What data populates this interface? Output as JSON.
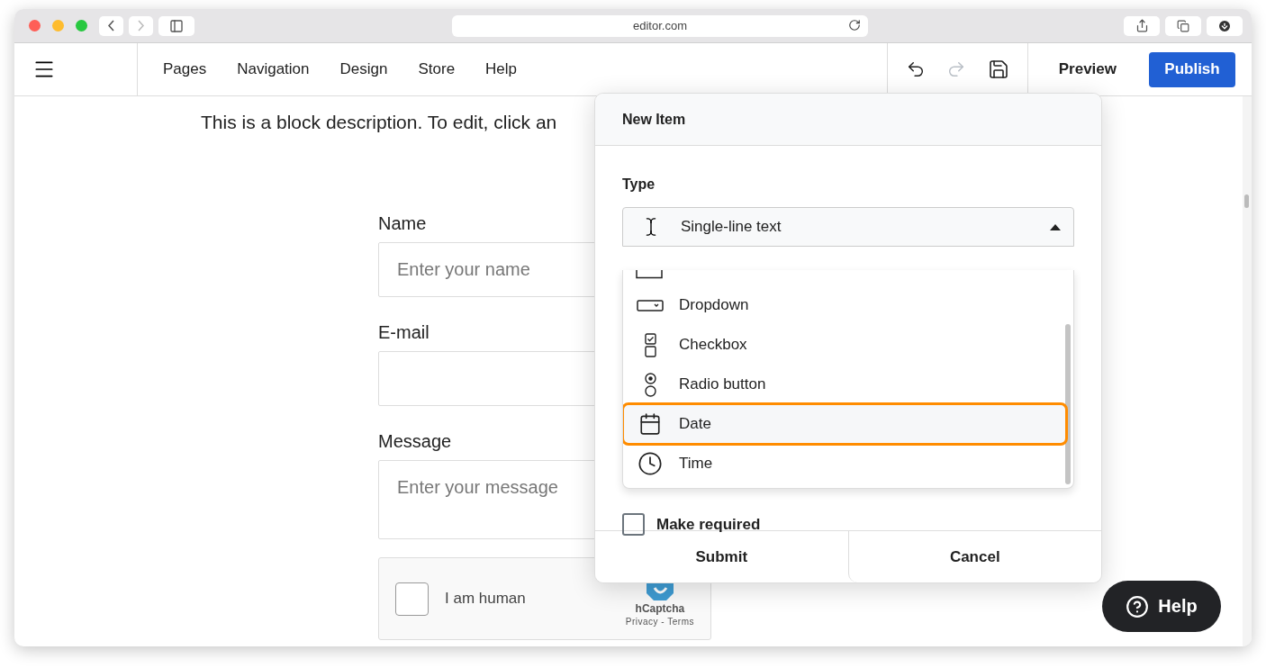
{
  "browser": {
    "url": "editor.com"
  },
  "header": {
    "nav": [
      {
        "label": "Pages"
      },
      {
        "label": "Navigation"
      },
      {
        "label": "Design"
      },
      {
        "label": "Store"
      },
      {
        "label": "Help"
      }
    ],
    "undo": {
      "disabled": false
    },
    "redo": {
      "disabled": true
    },
    "preview": "Preview",
    "publish": "Publish"
  },
  "page": {
    "description": "This is a block description. To edit, click an",
    "fields": [
      {
        "label": "Name",
        "placeholder": "Enter your name",
        "kind": "input"
      },
      {
        "label": "E-mail",
        "kind": "input"
      },
      {
        "label": "Message",
        "placeholder": "Enter your message",
        "kind": "textarea"
      }
    ],
    "captcha": {
      "label": "I am human",
      "checked": false,
      "brand": "hCaptcha",
      "links": "Privacy - Terms"
    }
  },
  "dialog": {
    "title": "New Item",
    "type_label": "Type",
    "type_select": {
      "value": "Single-line text",
      "expanded": true
    },
    "options": [
      {
        "label": "Dropdown",
        "kind": "dropdown",
        "selected": false
      },
      {
        "label": "Checkbox",
        "kind": "checkbox",
        "selected": false
      },
      {
        "label": "Radio button",
        "kind": "radio",
        "selected": false
      },
      {
        "label": "Date",
        "kind": "date",
        "selected": true
      },
      {
        "label": "Time",
        "kind": "time",
        "selected": false
      }
    ],
    "required": {
      "label": "Make required",
      "checked": false
    },
    "buttons": [
      "Submit",
      "Cancel"
    ]
  },
  "help_button": "Help"
}
